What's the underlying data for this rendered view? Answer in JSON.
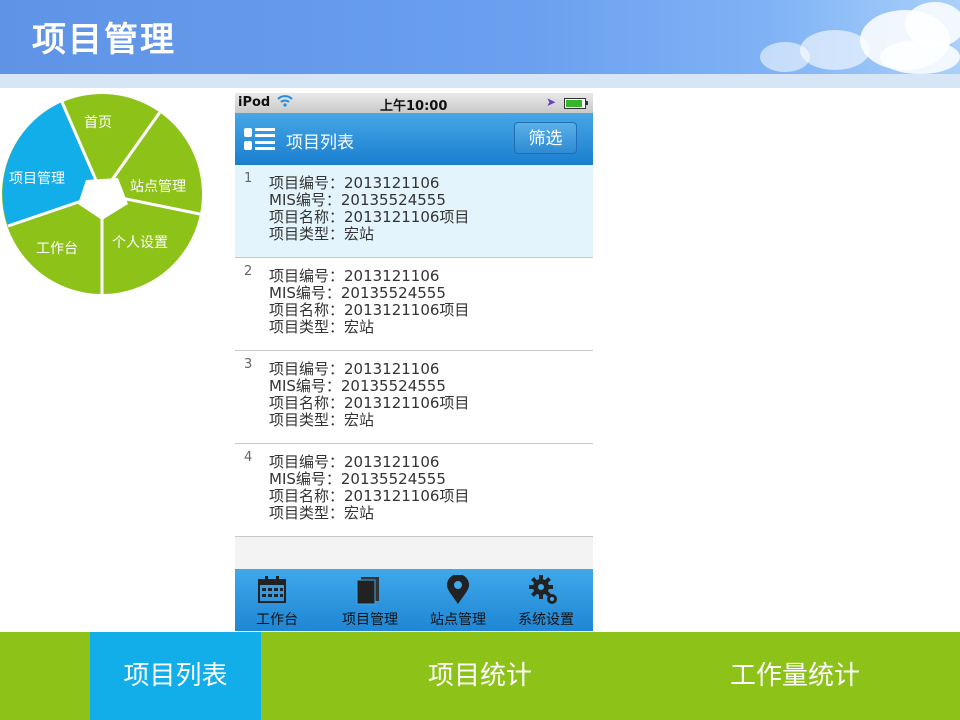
{
  "header": {
    "title": "项目管理"
  },
  "pie_menu": {
    "items": [
      {
        "label": "首页"
      },
      {
        "label": "站点管理"
      },
      {
        "label": "个人设置"
      },
      {
        "label": "工作台"
      },
      {
        "label": "项目管理"
      }
    ],
    "colors": {
      "default": "#8dc219",
      "active": "#11aee9"
    }
  },
  "phone": {
    "status": {
      "carrier": "iPod",
      "time": "上午10:00"
    },
    "nav": {
      "title": "项目列表",
      "filter_label": "筛选"
    },
    "items": [
      {
        "num": "1",
        "lines": [
          "项目编号：2013121106",
          "MIS编号：20135524555",
          "项目名称：2013121106项目",
          "项目类型：宏站"
        ],
        "selected": true
      },
      {
        "num": "2",
        "lines": [
          "项目编号：2013121106",
          "MIS编号：20135524555",
          "项目名称：2013121106项目",
          "项目类型：宏站"
        ],
        "selected": false
      },
      {
        "num": "3",
        "lines": [
          "项目编号：2013121106",
          "MIS编号：20135524555",
          "项目名称：2013121106项目",
          "项目类型：宏站"
        ],
        "selected": false
      },
      {
        "num": "4",
        "lines": [
          "项目编号：2013121106",
          "MIS编号：20135524555",
          "项目名称：2013121106项目",
          "项目类型：宏站"
        ],
        "selected": false
      }
    ],
    "tabs": [
      {
        "label": "工作台",
        "icon": "calendar-icon"
      },
      {
        "label": "项目管理",
        "icon": "document-icon"
      },
      {
        "label": "站点管理",
        "icon": "map-pin-icon"
      },
      {
        "label": "系统设置",
        "icon": "gear-icon"
      }
    ]
  },
  "bottom_tabs": [
    {
      "label": "项目列表",
      "active": true
    },
    {
      "label": "项目统计",
      "active": false
    },
    {
      "label": "工作量统计",
      "active": false
    }
  ]
}
